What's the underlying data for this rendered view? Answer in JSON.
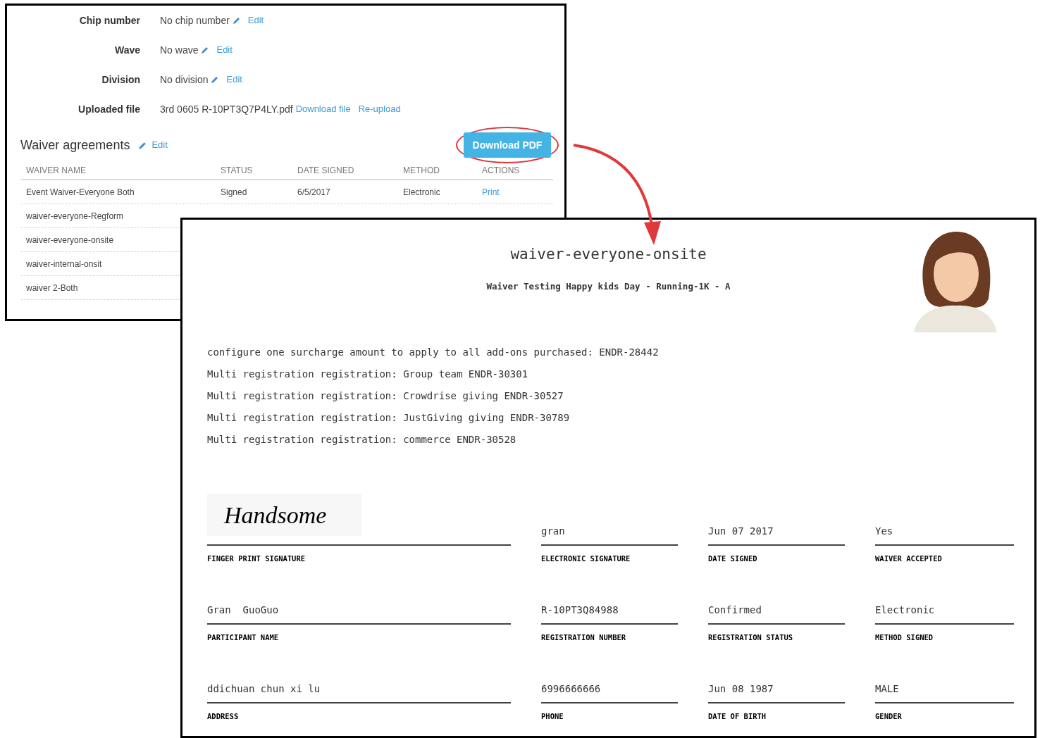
{
  "record": {
    "fields": [
      {
        "kind": "editable",
        "label": "Chip number",
        "value": "No chip number",
        "edit": "Edit"
      },
      {
        "kind": "editable",
        "label": "Wave",
        "value": "No wave",
        "edit": "Edit"
      },
      {
        "kind": "editable",
        "label": "Division",
        "value": "No division",
        "edit": "Edit"
      },
      {
        "kind": "file",
        "label": "Uploaded file",
        "value": "3rd 0605 R-10PT3Q7P4LY.pdf",
        "links": [
          "Download file",
          "Re-upload"
        ]
      }
    ]
  },
  "waivers": {
    "title": "Waiver agreements",
    "edit": "Edit",
    "download_button": "Download PDF",
    "columns": [
      "WAIVER NAME",
      "STATUS",
      "DATE SIGNED",
      "METHOD",
      "ACTIONS"
    ],
    "rows": [
      {
        "name": "Event Waiver-Everyone Both",
        "status": "Signed",
        "date": "6/5/2017",
        "method": "Electronic",
        "action": "Print"
      },
      {
        "name": "waiver-everyone-Regform"
      },
      {
        "name": "waiver-everyone-onsite"
      },
      {
        "name": "waiver-internal-onsit"
      },
      {
        "name": "waiver 2-Both"
      }
    ]
  },
  "document": {
    "title": "waiver-everyone-onsite",
    "subtitle": "Waiver Testing Happy kids Day - Running-1K - A",
    "lines": [
      "configure one surcharge amount to apply to all add-ons purchased: ENDR-28442",
      "Multi registration registration: Group team ENDR-30301",
      "Multi registration registration: Crowdrise giving ENDR-30527",
      "Multi registration registration: JustGiving giving ENDR-30789",
      "Multi registration registration: commerce ENDR-30528"
    ],
    "fields": [
      {
        "kind": "signature",
        "value": "Handsome",
        "label": "FINGER PRINT SIGNATURE"
      },
      {
        "kind": "text",
        "value": "gran",
        "label": "ELECTRONIC SIGNATURE"
      },
      {
        "kind": "text",
        "value": "Jun 07 2017",
        "label": "DATE SIGNED"
      },
      {
        "kind": "text",
        "value": "Yes",
        "label": "WAIVER ACCEPTED"
      },
      {
        "kind": "text",
        "value": "Gran  GuoGuo",
        "label": "PARTICIPANT NAME"
      },
      {
        "kind": "text",
        "value": "R-10PT3Q84988",
        "label": "REGISTRATION NUMBER"
      },
      {
        "kind": "text",
        "value": "Confirmed",
        "label": "REGISTRATION STATUS"
      },
      {
        "kind": "text",
        "value": "Electronic",
        "label": "METHOD SIGNED"
      },
      {
        "kind": "text",
        "value": "ddichuan chun xi lu",
        "label": "ADDRESS"
      },
      {
        "kind": "text",
        "value": "6996666666",
        "label": "PHONE"
      },
      {
        "kind": "text",
        "value": "Jun 08 1987",
        "label": "DATE OF BIRTH"
      },
      {
        "kind": "text",
        "value": "MALE",
        "label": "GENDER"
      }
    ]
  }
}
